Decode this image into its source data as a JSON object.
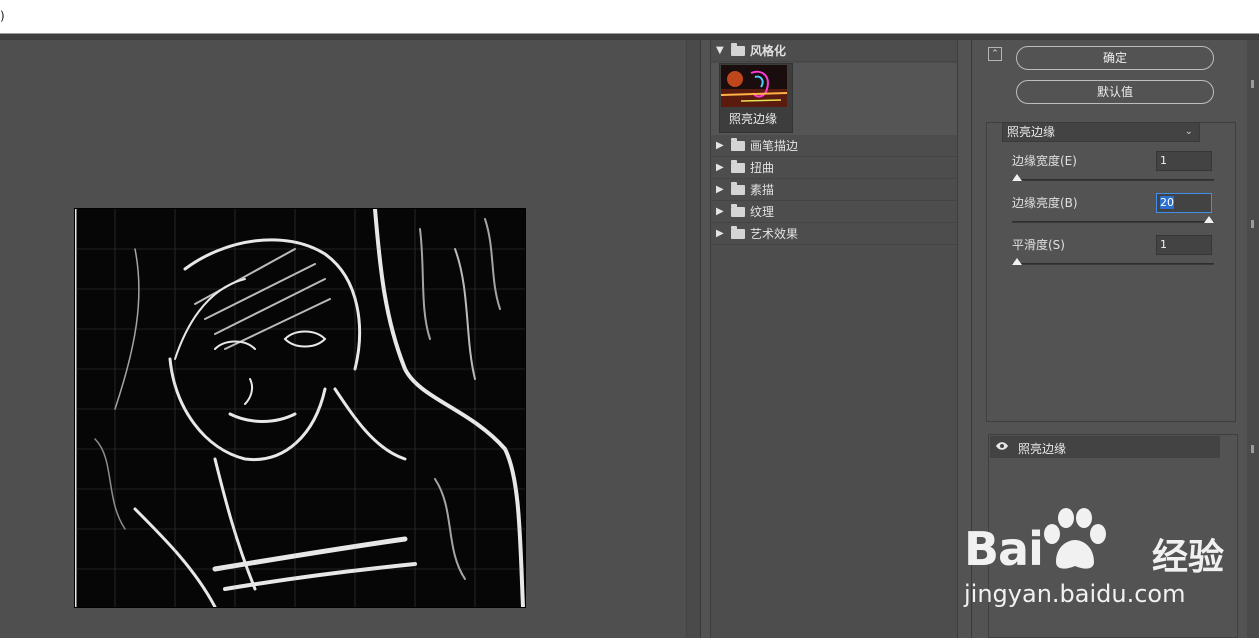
{
  "window": {
    "title_fragment": ")"
  },
  "gallery": {
    "open_category": "风格化",
    "open_filter": "照亮边缘",
    "categories": [
      "画笔描边",
      "扭曲",
      "素描",
      "纹理",
      "艺术效果"
    ]
  },
  "controls": {
    "ok_label": "确定",
    "default_label": "默认值",
    "filter_select": "照亮边缘",
    "params": [
      {
        "label": "边缘宽度(E)",
        "value": "1",
        "slider_fraction": 0.0
      },
      {
        "label": "边缘亮度(B)",
        "value": "20",
        "slider_fraction": 1.0
      },
      {
        "label": "平滑度(S)",
        "value": "1",
        "slider_fraction": 0.0
      }
    ]
  },
  "layers": {
    "active_layer": "照亮边缘"
  },
  "watermark": {
    "brand": "Bai",
    "brand2": "经验",
    "url": "jingyan.baidu.com"
  },
  "colors": {
    "accent_focus": "#3f8ee8",
    "panel_bg": "#535353"
  }
}
